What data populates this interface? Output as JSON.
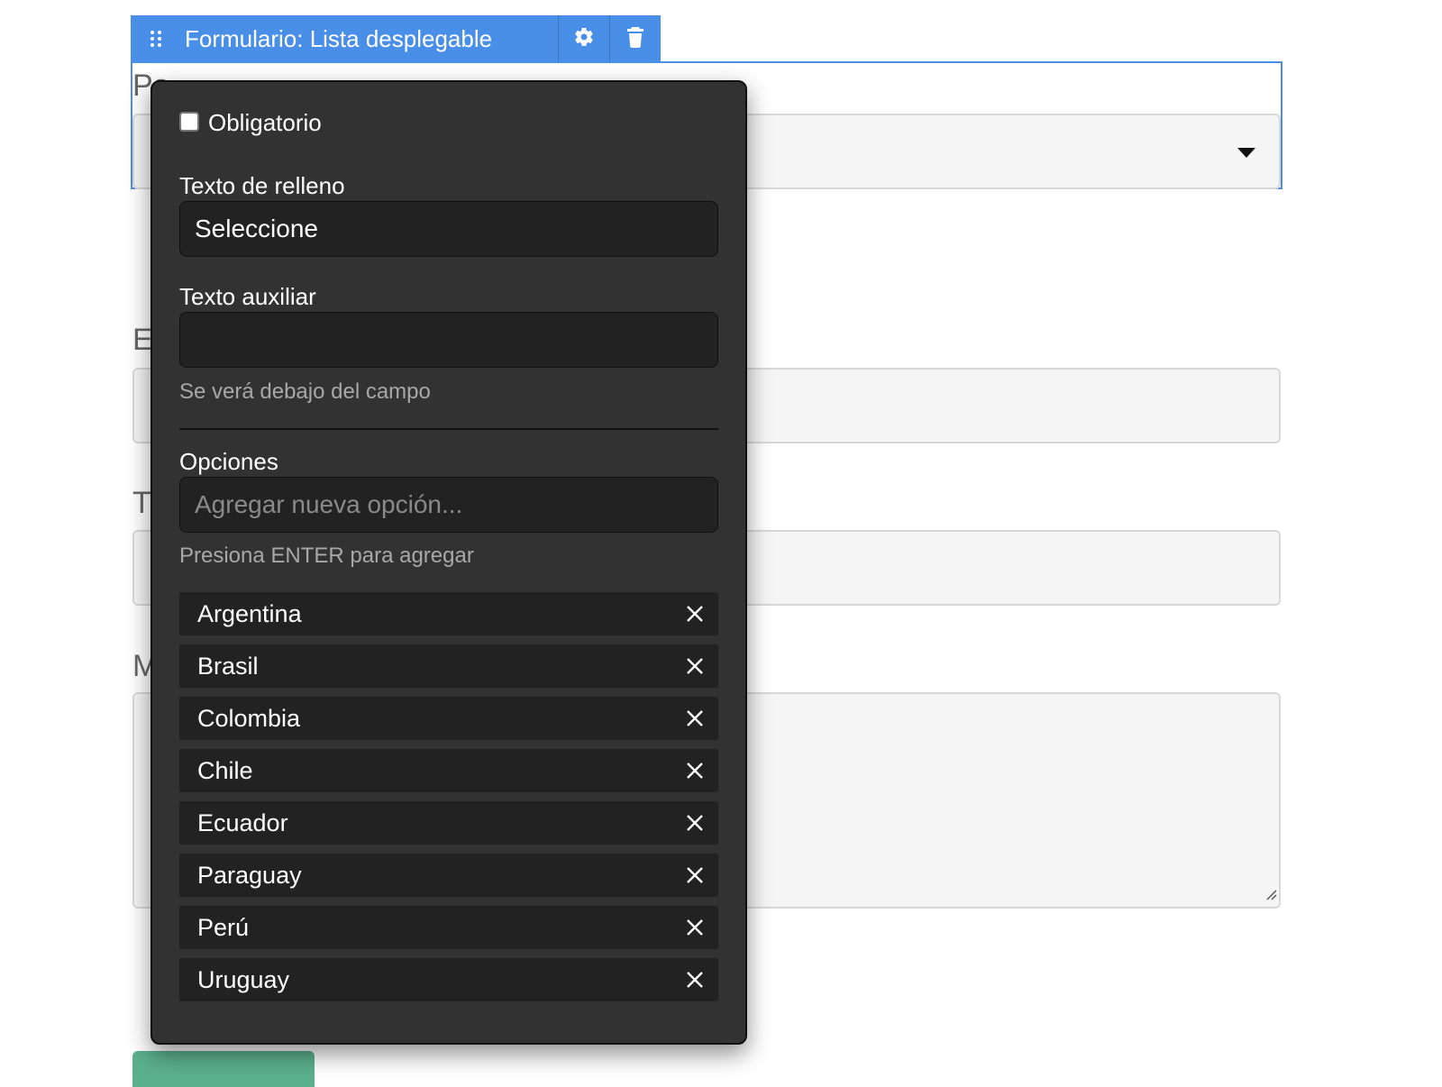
{
  "block_toolbar": {
    "title": "Formulario: Lista desplegable",
    "drag_icon": "drag-handle-icon",
    "settings_icon": "gear-icon",
    "delete_icon": "trash-icon",
    "accent_color": "#4a8fe7"
  },
  "form_background": {
    "field_labels": [
      "Pa",
      "E",
      "T",
      "M"
    ]
  },
  "settings_panel": {
    "required_label": "Obligatorio",
    "required_checked": false,
    "placeholder_label": "Texto de relleno",
    "placeholder_value": "Seleccione",
    "helper_label": "Texto auxiliar",
    "helper_value": "",
    "helper_hint": "Se verá debajo del campo",
    "options_label": "Opciones",
    "new_option_placeholder": "Agregar nueva opción...",
    "new_option_hint": "Presiona ENTER para agregar",
    "options": [
      "Argentina",
      "Brasil",
      "Colombia",
      "Chile",
      "Ecuador",
      "Paraguay",
      "Perú",
      "Uruguay"
    ],
    "remove_icon": "close-icon"
  }
}
